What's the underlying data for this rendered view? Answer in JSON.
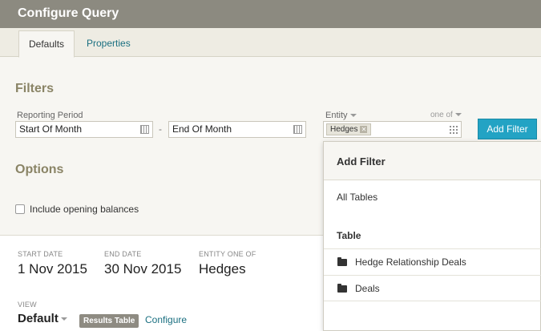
{
  "window": {
    "title": "Configure Query"
  },
  "tabs": [
    {
      "label": "Defaults",
      "active": true
    },
    {
      "label": "Properties",
      "active": false
    }
  ],
  "filters": {
    "heading": "Filters",
    "reporting_period": {
      "label": "Reporting Period",
      "start": "Start Of Month",
      "end": "End Of Month",
      "separator": "-"
    },
    "entity": {
      "label": "Entity",
      "operator": "one of",
      "tags": [
        "Hedges"
      ]
    },
    "add_filter_button": "Add Filter"
  },
  "options": {
    "heading": "Options",
    "include_opening_balances": {
      "label": "Include opening balances",
      "checked": false
    }
  },
  "summary": {
    "start_date_label": "START DATE",
    "start_date_value": "1 Nov 2015",
    "end_date_label": "END DATE",
    "end_date_value": "30 Nov 2015",
    "entity_label": "ENTITY ONE OF",
    "entity_value": "Hedges",
    "view_label": "VIEW",
    "view_value": "Default",
    "view_badge": "Results Table",
    "configure_link": "Configure"
  },
  "add_filter_dropdown": {
    "title": "Add Filter",
    "all_tables": "All Tables",
    "section": "Table",
    "items": [
      "Hedge Relationship Deals",
      "Deals"
    ]
  },
  "colors": {
    "titlebar": "#8c8a80",
    "primary_button": "#23a3c4",
    "link": "#1a6f80",
    "section_heading": "#8a8466"
  }
}
